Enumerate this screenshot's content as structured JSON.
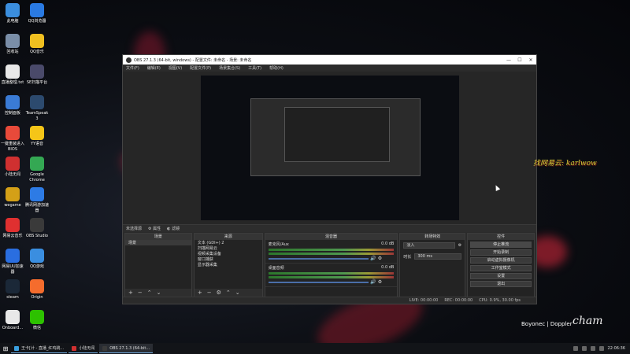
{
  "desktop": {
    "icons": [
      {
        "label": "此电脑",
        "icon": "computer-icon",
        "color": "#3b8ede"
      },
      {
        "label": "QQ浏览器",
        "icon": "qq-browser-icon",
        "color": "#2a7ae2"
      },
      {
        "label": "回收站",
        "icon": "recycle-bin-icon",
        "color": "#7a8ea8"
      },
      {
        "label": "QQ音乐",
        "icon": "qq-music-icon",
        "color": "#f0c020"
      },
      {
        "label": "直播整理.txt",
        "icon": "text-file-icon",
        "color": "#e8e8e8"
      },
      {
        "label": "SE扫描平台",
        "icon": "se-scan-icon",
        "color": "#4a4a6a"
      },
      {
        "label": "控制面板",
        "icon": "control-panel-icon",
        "color": "#3a7bd5"
      },
      {
        "label": "TeamSpeak 3",
        "icon": "teamspeak-icon",
        "color": "#2c4a6e"
      },
      {
        "label": "一键重装进入BIOS",
        "icon": "bios-icon",
        "color": "#e84a3a"
      },
      {
        "label": "YY语音",
        "icon": "yy-icon",
        "color": "#f5c518"
      },
      {
        "label": "小陆无闻",
        "icon": "app-icon",
        "color": "#d03030"
      },
      {
        "label": "Google Chrome",
        "icon": "chrome-icon",
        "color": "#34a853"
      },
      {
        "label": "wegame",
        "icon": "wegame-icon",
        "color": "#d4a017"
      },
      {
        "label": "腾讯网游加速器",
        "icon": "accelerator-icon",
        "color": "#2d7be5"
      },
      {
        "label": "网易云音乐",
        "icon": "netease-music-icon",
        "color": "#e03030"
      },
      {
        "label": "OBS Studio",
        "icon": "obs-icon",
        "color": "#3a3a3a"
      },
      {
        "label": "网易UU加速器",
        "icon": "uu-icon",
        "color": "#2a6ee0"
      },
      {
        "label": "QQ游戏",
        "icon": "qq-game-icon",
        "color": "#3a8ee0"
      },
      {
        "label": "steam",
        "icon": "steam-icon",
        "color": "#1b2838"
      },
      {
        "label": "Origin",
        "icon": "origin-icon",
        "color": "#f56c2d"
      },
      {
        "label": "Onboard...",
        "icon": "onboard-icon",
        "color": "#e8e8e8"
      },
      {
        "label": "微信",
        "icon": "wechat-icon",
        "color": "#2dc100"
      }
    ]
  },
  "obs": {
    "title": "OBS 27.1.3 (64-bit, windows) - 配置文件: 未命名 - 场景: 未命名",
    "menu": [
      "文件(F)",
      "编辑(E)",
      "视图(V)",
      "配置文件(P)",
      "场景集合(S)",
      "工具(T)",
      "帮助(H)"
    ],
    "source_bar": {
      "label": "未选择源",
      "properties": "属性",
      "filters": "滤镜"
    },
    "docks": {
      "scenes": {
        "title": "场景",
        "items": [
          "场景"
        ]
      },
      "sources": {
        "title": "来源",
        "items": [
          "文本 (GDI+) 2",
          "扫描网易云",
          "视频采集设备",
          "窗口捕获",
          "显示器采集"
        ]
      },
      "mixer": {
        "title": "混音器",
        "tracks": [
          {
            "name": "麦克风/Aux",
            "db": "0.0 dB"
          },
          {
            "name": "桌面音频",
            "db": "0.0 dB"
          }
        ]
      },
      "transitions": {
        "title": "转场特效",
        "type": "淡入",
        "duration_label": "时长",
        "duration": "300 ms"
      },
      "controls": {
        "title": "控件",
        "buttons": [
          "停止推流",
          "开始录制",
          "启动虚拟摄像机",
          "工作室模式",
          "设置",
          "退出"
        ]
      }
    },
    "status": {
      "live": "LIVE: 00:00:00",
      "rec": "REC: 00:00:00",
      "cpu": "CPU: 0.9%, 30.00 fps"
    }
  },
  "overlay": {
    "text": "找网易云: karlwow",
    "watermark": "Boyonec | Doppler",
    "signature": "cham"
  },
  "taskbar": {
    "tasks": [
      {
        "label": "王卡[计 - 直播_红鸡跳...",
        "color": "#3aa0e0"
      },
      {
        "label": "小陆无闻",
        "color": "#d03030"
      },
      {
        "label": "OBS 27.1.3 (64-bit...",
        "color": "#3a3a3a",
        "active": true
      }
    ],
    "clock": "22:06:36"
  }
}
